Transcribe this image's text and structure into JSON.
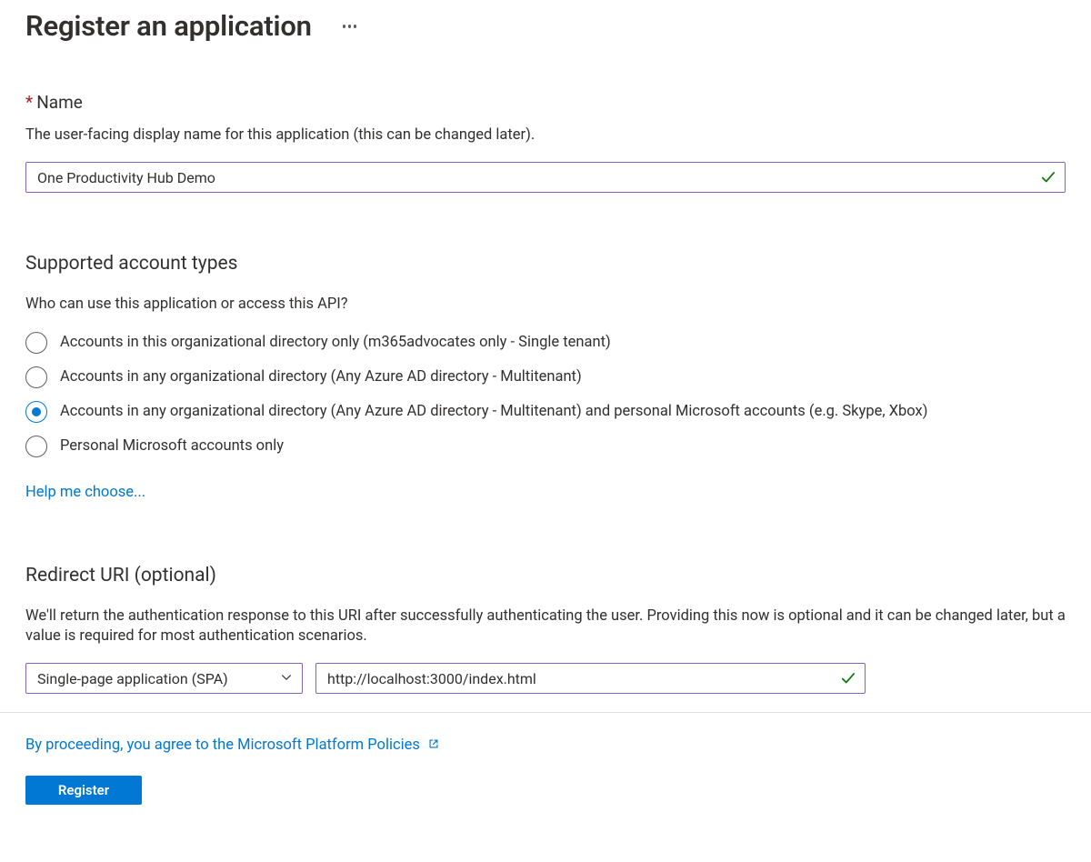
{
  "page": {
    "title": "Register an application"
  },
  "name": {
    "label": "Name",
    "required": true,
    "helper": "The user-facing display name for this application (this can be changed later).",
    "value": "One Productivity Hub Demo"
  },
  "account_types": {
    "title": "Supported account types",
    "question": "Who can use this application or access this API?",
    "options": [
      {
        "label": "Accounts in this organizational directory only (m365advocates only - Single tenant)",
        "selected": false
      },
      {
        "label": "Accounts in any organizational directory (Any Azure AD directory - Multitenant)",
        "selected": false
      },
      {
        "label": "Accounts in any organizational directory (Any Azure AD directory - Multitenant) and personal Microsoft accounts (e.g. Skype, Xbox)",
        "selected": true
      },
      {
        "label": "Personal Microsoft accounts only",
        "selected": false
      }
    ],
    "help_link": "Help me choose..."
  },
  "redirect_uri": {
    "title": "Redirect URI (optional)",
    "helper": "We'll return the authentication response to this URI after successfully authenticating the user. Providing this now is optional and it can be changed later, but a value is required for most authentication scenarios.",
    "platform": "Single-page application (SPA)",
    "value": "http://localhost:3000/index.html"
  },
  "footer": {
    "consent_prefix": "By proceeding, you agree to the ",
    "consent_link_text": "Microsoft Platform Policies",
    "register": "Register"
  }
}
